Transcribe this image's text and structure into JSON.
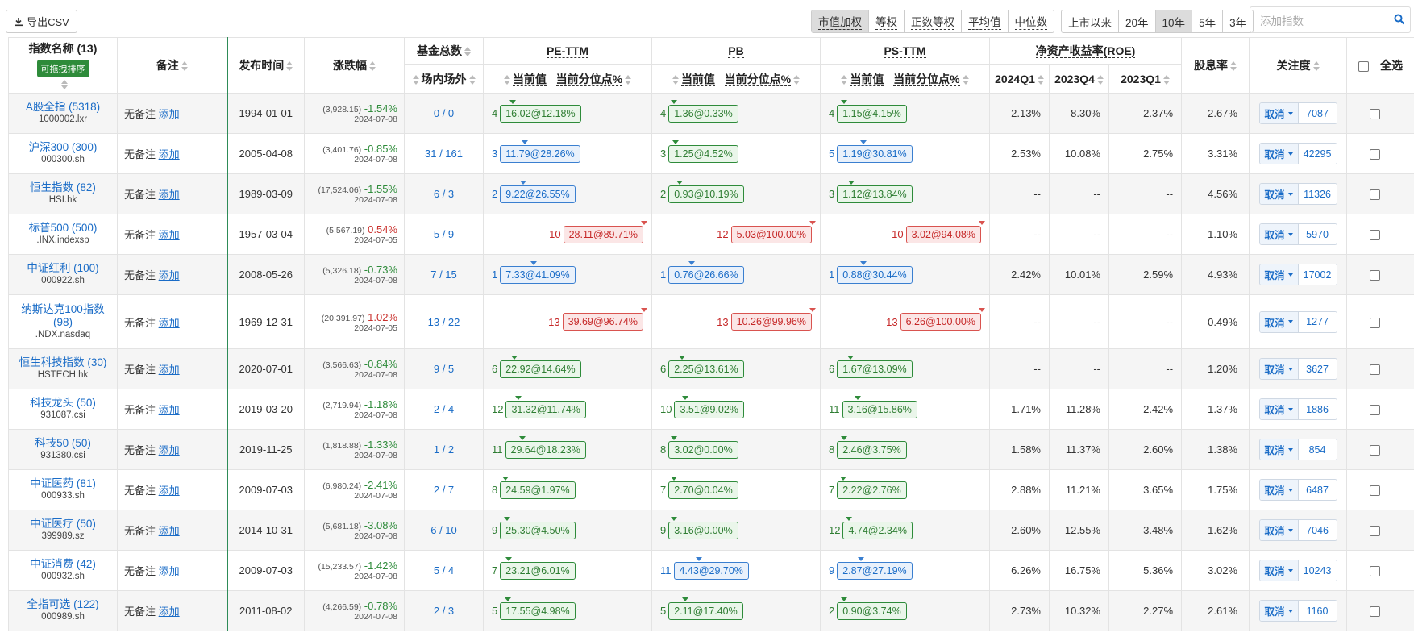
{
  "toolbar": {
    "export_label": "导出CSV",
    "weight_options": [
      "市值加权",
      "等权",
      "正数等权",
      "平均值",
      "中位数"
    ],
    "weight_active": 0,
    "period_options": [
      "上市以来",
      "20年",
      "10年",
      "5年",
      "3年"
    ],
    "period_active": 2,
    "search_placeholder": "添加指数"
  },
  "headers": {
    "name": "指数名称 (13)",
    "drag_tag": "可拖拽排序",
    "note": "备注",
    "publish": "发布时间",
    "change": "涨跌幅",
    "fund_total": "基金总数",
    "fund_sub": "场内场外",
    "pe": "PE-TTM",
    "pb": "PB",
    "ps": "PS-TTM",
    "cur_val": "当前值",
    "cur_pct": "当前分位点%",
    "roe": "净资产收益率(ROE)",
    "roe_q": [
      "2024Q1",
      "2023Q4",
      "2023Q1"
    ],
    "dividend": "股息率",
    "focus": "关注度",
    "select_all": "全选"
  },
  "note_text": "无备注",
  "note_add": "添加",
  "cancel_label": "取消",
  "rows": [
    {
      "name": "A股全指 (5318)",
      "code": "1000002.lxr",
      "date": "1994-01-01",
      "prev": "(3,928.15)",
      "chg": "-1.54%",
      "dir": "neg",
      "cdate": "2024-07-08",
      "f1": "0",
      "f2": "0",
      "pe": {
        "n": "4",
        "v": "16.02@12.18%",
        "c": "g"
      },
      "pb": {
        "n": "4",
        "v": "1.36@0.33%",
        "c": "g"
      },
      "ps": {
        "n": "4",
        "v": "1.15@4.15%",
        "c": "g"
      },
      "roe": [
        "2.13%",
        "8.30%",
        "2.37%"
      ],
      "div": "2.67%",
      "focus": "7087"
    },
    {
      "name": "沪深300 (300)",
      "code": "000300.sh",
      "date": "2005-04-08",
      "prev": "(3,401.76)",
      "chg": "-0.85%",
      "dir": "neg",
      "cdate": "2024-07-08",
      "f1": "31",
      "f2": "161",
      "pe": {
        "n": "3",
        "v": "11.79@28.26%",
        "c": "b"
      },
      "pb": {
        "n": "3",
        "v": "1.25@4.52%",
        "c": "g"
      },
      "ps": {
        "n": "5",
        "v": "1.19@30.81%",
        "c": "b"
      },
      "roe": [
        "2.53%",
        "10.08%",
        "2.75%"
      ],
      "div": "3.31%",
      "focus": "42295"
    },
    {
      "name": "恒生指数 (82)",
      "code": "HSI.hk",
      "date": "1989-03-09",
      "prev": "(17,524.06)",
      "chg": "-1.55%",
      "dir": "neg",
      "cdate": "2024-07-08",
      "f1": "6",
      "f2": "3",
      "pe": {
        "n": "2",
        "v": "9.22@26.55%",
        "c": "b"
      },
      "pb": {
        "n": "2",
        "v": "0.93@10.19%",
        "c": "g"
      },
      "ps": {
        "n": "3",
        "v": "1.12@13.84%",
        "c": "g"
      },
      "roe": [
        "--",
        "--",
        "--"
      ],
      "div": "4.56%",
      "focus": "11326"
    },
    {
      "name": "标普500 (500)",
      "code": ".INX.indexsp",
      "date": "1957-03-04",
      "prev": "(5,567.19)",
      "chg": "0.54%",
      "dir": "pos",
      "cdate": "2024-07-05",
      "f1": "5",
      "f2": "9",
      "pe": {
        "n": "10",
        "v": "28.11@89.71%",
        "c": "r"
      },
      "pb": {
        "n": "12",
        "v": "5.03@100.00%",
        "c": "r"
      },
      "ps": {
        "n": "10",
        "v": "3.02@94.08%",
        "c": "r"
      },
      "roe": [
        "--",
        "--",
        "--"
      ],
      "div": "1.10%",
      "focus": "5970"
    },
    {
      "name": "中证红利 (100)",
      "code": "000922.sh",
      "date": "2008-05-26",
      "prev": "(5,326.18)",
      "chg": "-0.73%",
      "dir": "neg",
      "cdate": "2024-07-08",
      "f1": "7",
      "f2": "15",
      "pe": {
        "n": "1",
        "v": "7.33@41.09%",
        "c": "b"
      },
      "pb": {
        "n": "1",
        "v": "0.76@26.66%",
        "c": "b"
      },
      "ps": {
        "n": "1",
        "v": "0.88@30.44%",
        "c": "b"
      },
      "roe": [
        "2.42%",
        "10.01%",
        "2.59%"
      ],
      "div": "4.93%",
      "focus": "17002"
    },
    {
      "name": "纳斯达克100指数 (98)",
      "code": ".NDX.nasdaq",
      "date": "1969-12-31",
      "prev": "(20,391.97)",
      "chg": "1.02%",
      "dir": "pos",
      "cdate": "2024-07-05",
      "f1": "13",
      "f2": "22",
      "pe": {
        "n": "13",
        "v": "39.69@96.74%",
        "c": "r"
      },
      "pb": {
        "n": "13",
        "v": "10.26@99.96%",
        "c": "r"
      },
      "ps": {
        "n": "13",
        "v": "6.26@100.00%",
        "c": "r"
      },
      "roe": [
        "--",
        "--",
        "--"
      ],
      "div": "0.49%",
      "focus": "1277",
      "tall": true
    },
    {
      "name": "恒生科技指数 (30)",
      "code": "HSTECH.hk",
      "date": "2020-07-01",
      "prev": "(3,566.63)",
      "chg": "-0.84%",
      "dir": "neg",
      "cdate": "2024-07-08",
      "f1": "9",
      "f2": "5",
      "pe": {
        "n": "6",
        "v": "22.92@14.64%",
        "c": "g"
      },
      "pb": {
        "n": "6",
        "v": "2.25@13.61%",
        "c": "g"
      },
      "ps": {
        "n": "6",
        "v": "1.67@13.09%",
        "c": "g"
      },
      "roe": [
        "--",
        "--",
        "--"
      ],
      "div": "1.20%",
      "focus": "3627"
    },
    {
      "name": "科技龙头 (50)",
      "code": "931087.csi",
      "date": "2019-03-20",
      "prev": "(2,719.94)",
      "chg": "-1.18%",
      "dir": "neg",
      "cdate": "2024-07-08",
      "f1": "2",
      "f2": "4",
      "pe": {
        "n": "12",
        "v": "31.32@11.74%",
        "c": "g"
      },
      "pb": {
        "n": "10",
        "v": "3.51@9.02%",
        "c": "g"
      },
      "ps": {
        "n": "11",
        "v": "3.16@15.86%",
        "c": "g"
      },
      "roe": [
        "1.71%",
        "11.28%",
        "2.42%"
      ],
      "div": "1.37%",
      "focus": "1886"
    },
    {
      "name": "科技50 (50)",
      "code": "931380.csi",
      "date": "2019-11-25",
      "prev": "(1,818.88)",
      "chg": "-1.33%",
      "dir": "neg",
      "cdate": "2024-07-08",
      "f1": "1",
      "f2": "2",
      "pe": {
        "n": "11",
        "v": "29.64@18.23%",
        "c": "g"
      },
      "pb": {
        "n": "8",
        "v": "3.02@0.00%",
        "c": "g"
      },
      "ps": {
        "n": "8",
        "v": "2.46@3.75%",
        "c": "g"
      },
      "roe": [
        "1.58%",
        "11.37%",
        "2.60%"
      ],
      "div": "1.38%",
      "focus": "854"
    },
    {
      "name": "中证医药 (81)",
      "code": "000933.sh",
      "date": "2009-07-03",
      "prev": "(6,980.24)",
      "chg": "-2.41%",
      "dir": "neg",
      "cdate": "2024-07-08",
      "f1": "2",
      "f2": "7",
      "pe": {
        "n": "8",
        "v": "24.59@1.97%",
        "c": "g"
      },
      "pb": {
        "n": "7",
        "v": "2.70@0.04%",
        "c": "g"
      },
      "ps": {
        "n": "7",
        "v": "2.22@2.76%",
        "c": "g"
      },
      "roe": [
        "2.88%",
        "11.21%",
        "3.65%"
      ],
      "div": "1.75%",
      "focus": "6487"
    },
    {
      "name": "中证医疗 (50)",
      "code": "399989.sz",
      "date": "2014-10-31",
      "prev": "(5,681.18)",
      "chg": "-3.08%",
      "dir": "neg",
      "cdate": "2024-07-08",
      "f1": "6",
      "f2": "10",
      "pe": {
        "n": "9",
        "v": "25.30@4.50%",
        "c": "g"
      },
      "pb": {
        "n": "9",
        "v": "3.16@0.00%",
        "c": "g"
      },
      "ps": {
        "n": "12",
        "v": "4.74@2.34%",
        "c": "g"
      },
      "roe": [
        "2.60%",
        "12.55%",
        "3.48%"
      ],
      "div": "1.62%",
      "focus": "7046"
    },
    {
      "name": "中证消费 (42)",
      "code": "000932.sh",
      "date": "2009-07-03",
      "prev": "(15,233.57)",
      "chg": "-1.42%",
      "dir": "neg",
      "cdate": "2024-07-08",
      "f1": "5",
      "f2": "4",
      "pe": {
        "n": "7",
        "v": "23.21@6.01%",
        "c": "g"
      },
      "pb": {
        "n": "11",
        "v": "4.43@29.70%",
        "c": "b"
      },
      "ps": {
        "n": "9",
        "v": "2.87@27.19%",
        "c": "b"
      },
      "roe": [
        "6.26%",
        "16.75%",
        "5.36%"
      ],
      "div": "3.02%",
      "focus": "10243"
    },
    {
      "name": "全指可选 (122)",
      "code": "000989.sh",
      "date": "2011-08-02",
      "prev": "(4,266.59)",
      "chg": "-0.78%",
      "dir": "neg",
      "cdate": "2024-07-08",
      "f1": "2",
      "f2": "3",
      "pe": {
        "n": "5",
        "v": "17.55@4.98%",
        "c": "g"
      },
      "pb": {
        "n": "5",
        "v": "2.11@17.40%",
        "c": "g"
      },
      "ps": {
        "n": "2",
        "v": "0.90@3.74%",
        "c": "g"
      },
      "roe": [
        "2.73%",
        "10.32%",
        "2.27%"
      ],
      "div": "2.61%",
      "focus": "1160"
    }
  ]
}
